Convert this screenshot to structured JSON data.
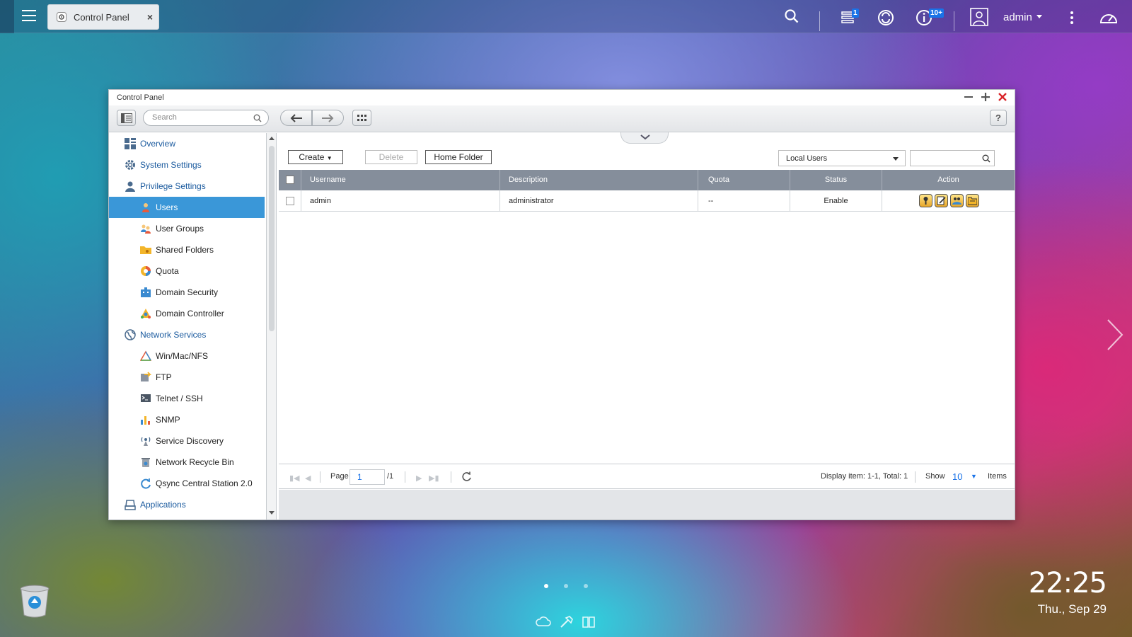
{
  "topbar": {
    "task_tab_label": "Control Panel",
    "tab_close": "×",
    "notifications_count": "1",
    "events_count": "10+",
    "user": "admin"
  },
  "window": {
    "title": "Control Panel",
    "search_placeholder": "Search",
    "help": "?"
  },
  "sidebar": {
    "items": [
      {
        "label": "Overview",
        "type": "cat",
        "icon": "overview-icon"
      },
      {
        "label": "System Settings",
        "type": "cat",
        "icon": "gear-icon"
      },
      {
        "label": "Privilege Settings",
        "type": "cat",
        "icon": "user-icon"
      },
      {
        "label": "Users",
        "type": "sub",
        "icon": "user-icon",
        "selected": true
      },
      {
        "label": "User Groups",
        "type": "sub",
        "icon": "user-group-icon"
      },
      {
        "label": "Shared Folders",
        "type": "sub",
        "icon": "folder-icon"
      },
      {
        "label": "Quota",
        "type": "sub",
        "icon": "pie-icon"
      },
      {
        "label": "Domain Security",
        "type": "sub",
        "icon": "domain-security-icon"
      },
      {
        "label": "Domain Controller",
        "type": "sub",
        "icon": "domain-controller-icon"
      },
      {
        "label": "Network Services",
        "type": "cat",
        "icon": "globe-icon"
      },
      {
        "label": "Win/Mac/NFS",
        "type": "sub",
        "icon": "triangle-icon"
      },
      {
        "label": "FTP",
        "type": "sub",
        "icon": "ftp-icon"
      },
      {
        "label": "Telnet / SSH",
        "type": "sub",
        "icon": "terminal-icon"
      },
      {
        "label": "SNMP",
        "type": "sub",
        "icon": "bar-chart-icon"
      },
      {
        "label": "Service Discovery",
        "type": "sub",
        "icon": "discovery-icon"
      },
      {
        "label": "Network Recycle Bin",
        "type": "sub",
        "icon": "recycle-bin-icon"
      },
      {
        "label": "Qsync Central Station 2.0",
        "type": "sub",
        "icon": "sync-icon"
      },
      {
        "label": "Applications",
        "type": "cat",
        "icon": "applications-icon"
      }
    ]
  },
  "toolbar": {
    "create": "Create",
    "delete": "Delete",
    "home_folder": "Home Folder",
    "user_type": "Local Users",
    "grid_search_value": ""
  },
  "table": {
    "columns": [
      "Username",
      "Description",
      "Quota",
      "Status",
      "Action"
    ],
    "rows": [
      {
        "username": "admin",
        "description": "administrator",
        "quota": "--",
        "status": "Enable"
      }
    ]
  },
  "pager": {
    "page_label": "Page",
    "page_value": "1",
    "total_pages": "/1",
    "display_info": "Display item: 1-1, Total: 1",
    "show_label": "Show",
    "show_value": "10",
    "items_label": "Items"
  },
  "desktop": {
    "time": "22:25",
    "date": "Thu., Sep 29"
  },
  "colors": {
    "selected_bg": "#3a97d8",
    "category_text": "#1a5a9e",
    "table_header": "#858e9b",
    "close_red": "#d9262b",
    "badge_blue": "#1a73e8"
  }
}
